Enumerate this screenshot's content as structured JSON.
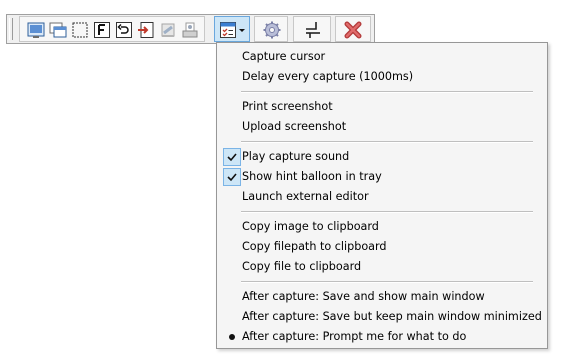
{
  "toolbar": {
    "buttons": [
      {
        "name": "capture-fullscreen-icon"
      },
      {
        "name": "capture-window-icon"
      },
      {
        "name": "capture-region-icon"
      },
      {
        "name": "capture-freehand-icon"
      },
      {
        "name": "capture-last-region-icon"
      },
      {
        "name": "capture-object-icon"
      },
      {
        "name": "capture-ie-icon"
      },
      {
        "name": "capture-clipboard-icon"
      }
    ],
    "dropdown_button": {
      "name": "options-dropdown-icon"
    },
    "settings_button": {
      "name": "settings-gear-icon"
    },
    "dock_button": {
      "name": "dock-icon"
    },
    "exit_button": {
      "name": "exit-icon"
    }
  },
  "menu": {
    "items": [
      {
        "label": "Capture cursor",
        "state": "none"
      },
      {
        "label": "Delay every capture (1000ms)",
        "state": "none"
      },
      {
        "label": "Print screenshot",
        "state": "none"
      },
      {
        "label": "Upload screenshot",
        "state": "none"
      },
      {
        "label": "Play capture sound",
        "state": "checked"
      },
      {
        "label": "Show hint balloon in tray",
        "state": "checked"
      },
      {
        "label": "Launch external editor",
        "state": "none"
      },
      {
        "label": "Copy image to clipboard",
        "state": "none"
      },
      {
        "label": "Copy filepath to clipboard",
        "state": "none"
      },
      {
        "label": "Copy file to clipboard",
        "state": "none"
      },
      {
        "label": "After capture: Save and show main window",
        "state": "none"
      },
      {
        "label": "After capture: Save but keep main window minimized",
        "state": "none"
      },
      {
        "label": "After capture: Prompt me for what to do",
        "state": "radio"
      }
    ]
  }
}
